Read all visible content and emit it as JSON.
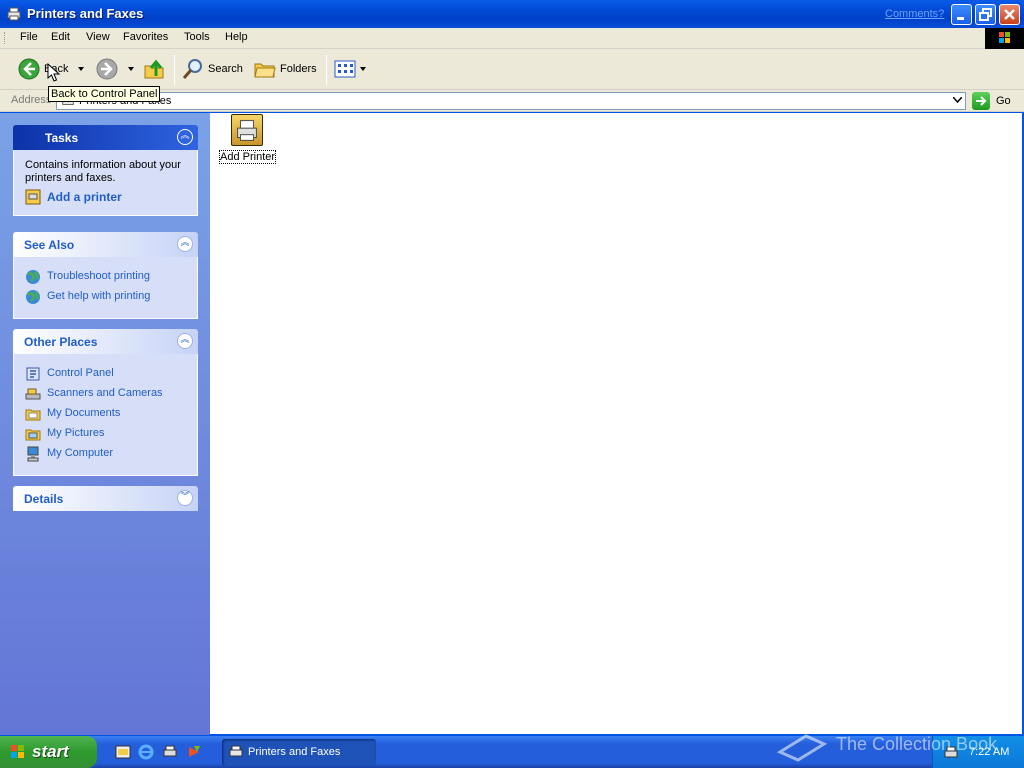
{
  "window": {
    "title": "Printers and Faxes",
    "comments_link": "Comments?",
    "icon": "printers-folder-icon",
    "controls": {
      "minimize": "minimize-icon",
      "maximize": "restore-icon",
      "close": "close-icon"
    }
  },
  "menu": {
    "items": [
      "File",
      "Edit",
      "View",
      "Favorites",
      "Tools",
      "Help"
    ]
  },
  "toolbar": {
    "back_label": "Back",
    "search_label": "Search",
    "folders_label": "Folders"
  },
  "address": {
    "label": "Address",
    "value": "Printers and Faxes",
    "go_label": "Go"
  },
  "tooltip": {
    "text": "Back to Control Panel"
  },
  "sidebar": {
    "tasks": {
      "title": "Tasks",
      "description": "Contains information about your printers and faxes.",
      "links": [
        {
          "label": "Add a printer",
          "icon": "add-printer-icon"
        }
      ]
    },
    "see_also": {
      "title": "See Also",
      "links": [
        {
          "label": "Troubleshoot printing",
          "icon": "globe-icon"
        },
        {
          "label": "Get help with printing",
          "icon": "globe-icon"
        }
      ]
    },
    "other_places": {
      "title": "Other Places",
      "links": [
        {
          "label": "Control Panel",
          "icon": "control-panel-icon"
        },
        {
          "label": "Scanners and Cameras",
          "icon": "scanner-icon"
        },
        {
          "label": "My Documents",
          "icon": "folder-icon"
        },
        {
          "label": "My Pictures",
          "icon": "folder-icon"
        },
        {
          "label": "My Computer",
          "icon": "computer-icon"
        }
      ]
    },
    "details": {
      "title": "Details"
    }
  },
  "content": {
    "items": [
      {
        "label": "Add Printer",
        "icon": "add-printer-icon"
      }
    ]
  },
  "taskbar": {
    "start_label": "start",
    "task_label": "Printers and Faxes",
    "clock": "7:22 AM",
    "tray_icon": "printer-tray-icon"
  },
  "watermark": {
    "text": "The Collection Book"
  },
  "colors": {
    "title_blue": "#0054e3",
    "link_blue": "#215dc6",
    "start_green": "#2e9a2e",
    "sidebar_blue": "#7ba2e7"
  }
}
